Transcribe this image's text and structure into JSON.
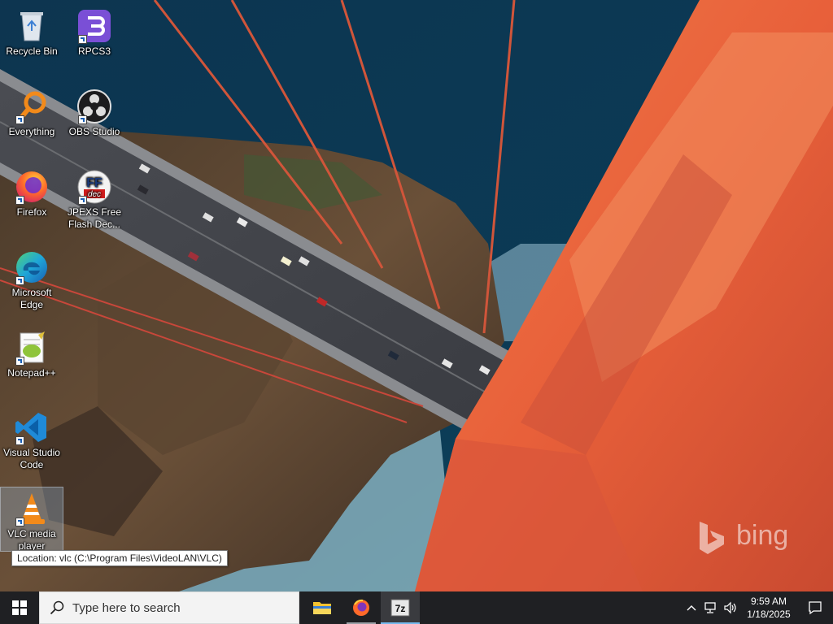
{
  "desktop": {
    "icons": [
      {
        "id": "recycle-bin",
        "label": "Recycle Bin"
      },
      {
        "id": "rpcs3",
        "label": "RPCS3"
      },
      {
        "id": "everything",
        "label": "Everything"
      },
      {
        "id": "obs-studio",
        "label": "OBS Studio"
      },
      {
        "id": "firefox",
        "label": "Firefox"
      },
      {
        "id": "jpexs",
        "label": "JPEXS Free Flash Dec..."
      },
      {
        "id": "microsoft-edge",
        "label": "Microsoft Edge"
      },
      {
        "id": "notepad-plus-plus",
        "label": "Notepad++"
      },
      {
        "id": "visual-studio-code",
        "label": "Visual Studio Code"
      },
      {
        "id": "vlc-media-player",
        "label": "VLC media player"
      }
    ],
    "ffdec_glyph_text": "FF",
    "ffdec_glyph_subtext": "dec",
    "tooltip": "Location: vlc (C:\\Program Files\\VideoLAN\\VLC)",
    "watermark": "bing"
  },
  "taskbar": {
    "search_placeholder": "Type here to search",
    "pinned": [
      "file-explorer",
      "firefox",
      "7-zip"
    ],
    "sevenzip_label": "7z",
    "clock": {
      "time": "9:59 AM",
      "date": "1/18/2025"
    }
  },
  "colors": {
    "taskbar_bg": "#1f2023",
    "accent": "#76b9ed",
    "bridge_orange": "#e8603a"
  }
}
